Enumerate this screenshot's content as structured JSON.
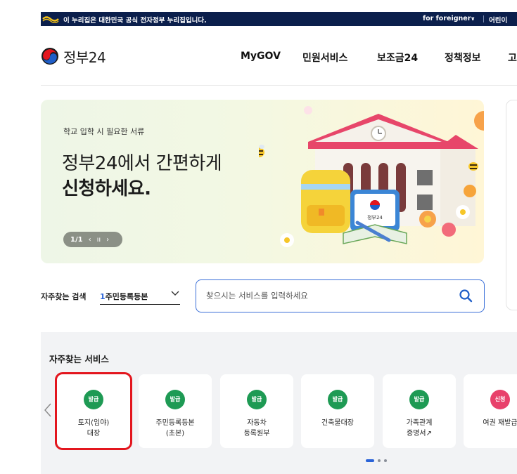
{
  "gov_bar": {
    "notice": "이 누리집은 대한민국 공식 전자정부 누리집입니다.",
    "foreigner": "for foreigner",
    "kids": "어린이"
  },
  "header": {
    "logo_text": "정부24",
    "nav": [
      "MyGOV",
      "민원서비스",
      "보조금24",
      "정책정보",
      "고"
    ]
  },
  "hero": {
    "subtitle": "학교 입학 시 필요한 서류",
    "title_line1": "정부24에서 간편하게",
    "title_line2": "신청하세요.",
    "pager_count": "1/1",
    "pager_prev": "‹",
    "pager_pause": "ıı",
    "pager_next": "›",
    "art_badge": "정부24"
  },
  "search": {
    "frequent_label": "자주찾는 검색",
    "frequent_rank": "1",
    "frequent_term": "주민등록등본",
    "placeholder": "찾으시는 서비스를 입력하세요"
  },
  "services": {
    "title": "자주찾는 서비스",
    "items": [
      {
        "badge": "발급",
        "badge_color": "#1e9a54",
        "line1": "토지(임야)",
        "line2": "대장",
        "selected": true
      },
      {
        "badge": "발급",
        "badge_color": "#1e9a54",
        "line1": "주민등록등본",
        "line2": "(초본)"
      },
      {
        "badge": "발급",
        "badge_color": "#1e9a54",
        "line1": "자동차",
        "line2": "등록원부"
      },
      {
        "badge": "발급",
        "badge_color": "#1e9a54",
        "line1": "건축물대장",
        "line2": ""
      },
      {
        "badge": "발급",
        "badge_color": "#1e9a54",
        "line1": "가족관계",
        "line2": "증명서↗"
      },
      {
        "badge": "신청",
        "badge_color": "#e8416b",
        "line1": "여권 재발급",
        "line2": ""
      }
    ],
    "pagination": {
      "pages": 3,
      "current": 1
    }
  },
  "colors": {
    "gov_bar": "#0b1f4c",
    "accent_blue": "#2a63d8",
    "selected_outline": "#e3161e"
  }
}
